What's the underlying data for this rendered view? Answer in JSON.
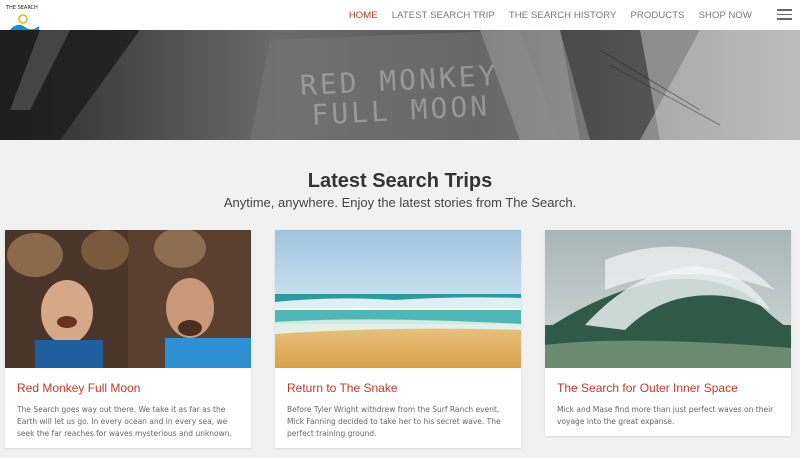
{
  "header": {
    "logo_text": "THE SEARCH",
    "nav": [
      {
        "label": "HOME",
        "active": true
      },
      {
        "label": "LATEST SEARCH TRIP",
        "active": false
      },
      {
        "label": "THE SEARCH HISTORY",
        "active": false
      },
      {
        "label": "PRODUCTS",
        "active": false
      },
      {
        "label": "SHOP NOW",
        "active": false
      }
    ],
    "menu_icon": "hamburger-menu-icon"
  },
  "hero": {
    "line1": "RED MONKEY",
    "line2": "FULL MOON"
  },
  "section": {
    "title": "Latest Search Trips",
    "subtitle": "Anytime, anywhere. Enjoy the latest stories from The Search."
  },
  "cards": [
    {
      "title": "Red Monkey Full Moon",
      "text": "The Search goes way out there. We take it as far as the Earth will let us go. In every ocean and in every sea, we seek the far reaches for waves mysterious and unknown."
    },
    {
      "title": "Return to The Snake",
      "text": "Before Tyler Wright withdrew from the Surf Ranch event, Mick Fanning decided to take her to his secret wave. The perfect training ground."
    },
    {
      "title": "The Search for Outer Inner Space",
      "text": "Mick and Mase find more than just perfect waves on their voyage into the great expanse."
    }
  ],
  "colors": {
    "accent": "#c33a24",
    "background": "#f1f1f1",
    "card": "#ffffff"
  }
}
